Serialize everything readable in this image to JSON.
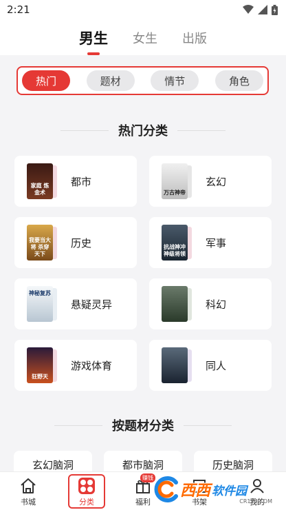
{
  "status_bar": {
    "time": "2:21"
  },
  "gender_tabs": [
    {
      "label": "男生",
      "active": true
    },
    {
      "label": "女生",
      "active": false
    },
    {
      "label": "出版",
      "active": false
    }
  ],
  "filters": [
    {
      "label": "热门",
      "active": true
    },
    {
      "label": "题材",
      "active": false
    },
    {
      "label": "情节",
      "active": false
    },
    {
      "label": "角色",
      "active": false
    }
  ],
  "hot_section": {
    "title": "热门分类",
    "categories": [
      {
        "label": "都市",
        "cover_text": "家庭 炼金术",
        "cover_color": "#5a2a1e"
      },
      {
        "label": "玄幻",
        "cover_text": "万古神帝",
        "cover_color": "#dcdcdc"
      },
      {
        "label": "历史",
        "cover_text": "我要当大将 杀穿天下",
        "cover_color": "#b2782a"
      },
      {
        "label": "军事",
        "cover_text": "抗战神冲 神级将领",
        "cover_color": "#2d3b4a"
      },
      {
        "label": "悬疑灵异",
        "cover_text": "神秘复苏",
        "cover_color": "#e8eef3"
      },
      {
        "label": "科幻",
        "cover_text": "",
        "cover_color": "#3a4a3a"
      },
      {
        "label": "游戏体育",
        "cover_text": "狂野天",
        "cover_color": "#7a2a1e"
      },
      {
        "label": "同人",
        "cover_text": "",
        "cover_color": "#2b3a4a"
      }
    ]
  },
  "theme_section": {
    "title": "按题材分类",
    "items": [
      "玄幻脑洞",
      "都市脑洞",
      "历史脑洞"
    ]
  },
  "bottom_nav": [
    {
      "label": "书城",
      "icon": "home-icon"
    },
    {
      "label": "分类",
      "icon": "category-icon",
      "active": true
    },
    {
      "label": "福利",
      "icon": "gift-icon",
      "badge": "赚钱"
    },
    {
      "label": "书架",
      "icon": "bookshelf-icon"
    },
    {
      "label": "我的",
      "icon": "profile-icon"
    }
  ],
  "watermark": {
    "main": "西西",
    "sub": "软件园",
    "url": "CR173.COM"
  },
  "colors": {
    "accent": "#e53935",
    "background": "#f4f4f6"
  }
}
